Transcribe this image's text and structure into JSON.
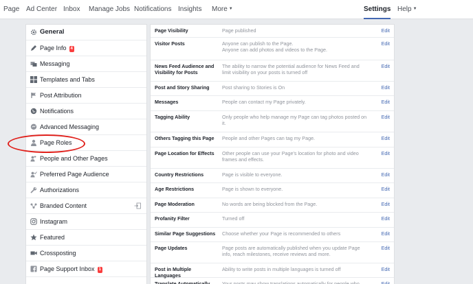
{
  "topnav": {
    "page": "Page",
    "ad_center": "Ad Center",
    "inbox": "Inbox",
    "manage_jobs": "Manage Jobs",
    "notifications": "Notifications",
    "insights": "Insights",
    "more": "More",
    "settings": "Settings",
    "help": "Help"
  },
  "sidebar": {
    "items": [
      {
        "label": "General",
        "icon": "gear-icon"
      },
      {
        "label": "Page Info",
        "icon": "pencil-icon",
        "badge": "4"
      },
      {
        "label": "Messaging",
        "icon": "messaging-icon"
      },
      {
        "label": "Templates and Tabs",
        "icon": "grid-icon"
      },
      {
        "label": "Post Attribution",
        "icon": "flag-icon"
      },
      {
        "label": "Notifications",
        "icon": "globe-icon"
      },
      {
        "label": "Advanced Messaging",
        "icon": "chat-bubble-icon"
      },
      {
        "label": "Page Roles",
        "icon": "person-icon"
      },
      {
        "label": "People and Other Pages",
        "icon": "people-icon"
      },
      {
        "label": "Preferred Page Audience",
        "icon": "audience-icon"
      },
      {
        "label": "Authorizations",
        "icon": "wrench-icon"
      },
      {
        "label": "Branded Content",
        "icon": "handshake-icon"
      },
      {
        "label": "Instagram",
        "icon": "instagram-icon"
      },
      {
        "label": "Featured",
        "icon": "star-icon"
      },
      {
        "label": "Crossposting",
        "icon": "video-icon"
      },
      {
        "label": "Page Support Inbox",
        "icon": "facebook-icon",
        "badge": "1"
      }
    ]
  },
  "settings": {
    "edit_label": "Edit",
    "rows": [
      {
        "name": "Page Visibility",
        "desc": [
          "Page published"
        ]
      },
      {
        "name": "Visitor Posts",
        "desc": [
          "Anyone can publish to the Page.",
          "Anyone can add photos and videos to the Page."
        ]
      },
      {
        "name": "News Feed Audience and Visibility for Posts",
        "desc": [
          "The ability to narrow the potential audience for News Feed and",
          "limit visibility on your posts is turned off"
        ]
      },
      {
        "name": "Post and Story Sharing",
        "desc": [
          "Post sharing to Stories is On"
        ]
      },
      {
        "name": "Messages",
        "desc": [
          "People can contact my Page privately."
        ]
      },
      {
        "name": "Tagging Ability",
        "desc": [
          "Only people who help manage my Page can tag photos posted on",
          "it."
        ]
      },
      {
        "name": "Others Tagging this Page",
        "desc": [
          "People and other Pages can tag my Page."
        ]
      },
      {
        "name": "Page Location for Effects",
        "desc": [
          "Other people can use your Page's location for photo and video",
          "frames and effects."
        ]
      },
      {
        "name": "Country Restrictions",
        "desc": [
          "Page is visible to everyone."
        ]
      },
      {
        "name": "Age Restrictions",
        "desc": [
          "Page is shown to everyone."
        ]
      },
      {
        "name": "Page Moderation",
        "desc": [
          "No words are being blocked from the Page."
        ]
      },
      {
        "name": "Profanity Filter",
        "desc": [
          "Turned off"
        ]
      },
      {
        "name": "Similar Page Suggestions",
        "desc": [
          "Choose whether your Page is recommended to others"
        ]
      },
      {
        "name": "Page Updates",
        "desc": [
          "Page posts are automatically published when you update Page",
          "info, reach milestones, receive reviews and more."
        ]
      },
      {
        "name": "Post in Multiple Languages",
        "desc": [
          "Ability to write posts in multiple languages is turned off"
        ]
      },
      {
        "name": "Translate Automatically",
        "desc": [
          "Your posts may show translations automatically for people who"
        ]
      }
    ]
  },
  "colors": {
    "accent": "#4267b2",
    "highlight_oval": "#e0201b",
    "badge": "#fa3e3e"
  }
}
